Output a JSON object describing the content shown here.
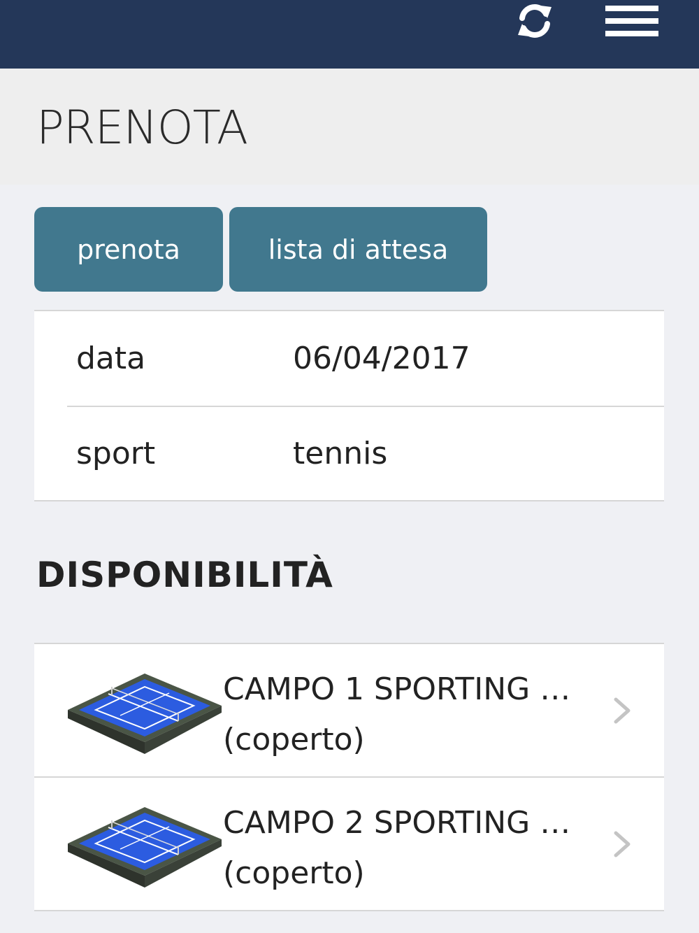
{
  "header": {
    "refresh_icon": "refresh-icon",
    "menu_icon": "hamburger-menu-icon",
    "background_color": "#243759"
  },
  "page": {
    "title": "PRENOTA"
  },
  "tabs": [
    {
      "label": "prenota"
    },
    {
      "label": "lista di attesa"
    }
  ],
  "info": {
    "date_label": "data",
    "date_value": "06/04/2017",
    "sport_label": "sport",
    "sport_value": "tennis"
  },
  "availability": {
    "title": "DISPONIBILITÀ",
    "courts": [
      {
        "name": "CAMPO 1 SPORTING …",
        "subtitle": "(coperto)",
        "icon": "tennis-court-icon"
      },
      {
        "name": "CAMPO 2 SPORTING …",
        "subtitle": "(coperto)",
        "icon": "tennis-court-icon"
      }
    ]
  },
  "colors": {
    "accent": "#41788e",
    "page_bg": "#eff0f4"
  }
}
